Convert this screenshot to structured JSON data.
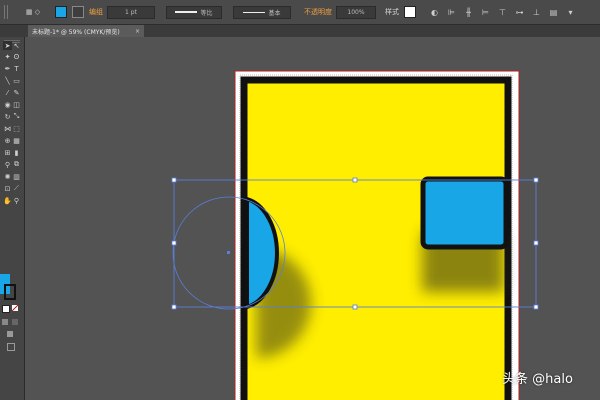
{
  "control_bar": {
    "selection_label": "编组",
    "stroke_weight": "1 pt",
    "stroke_profile": "等比",
    "brush_def": "基本",
    "opacity_label": "不透明度",
    "opacity_value": "100%",
    "style_label": "样式"
  },
  "document_tab": {
    "title": "未标题-1* @ 59% (CMYK/预览)",
    "close": "×"
  },
  "colors": {
    "fill": "#18a6e6",
    "yellow": "#ffee00",
    "stroke": "#111111",
    "artboard_border": "#b11f1f",
    "selection": "#5a7fd6"
  },
  "tools": [
    "selection-tool",
    "direct-selection-tool",
    "magic-wand-tool",
    "pen-tool",
    "type-tool",
    "line-tool",
    "rectangle-tool",
    "paintbrush-tool",
    "pencil-tool",
    "eraser-tool",
    "rotate-tool",
    "scale-tool",
    "width-tool",
    "free-transform-tool",
    "shape-builder-tool",
    "perspective-grid-tool",
    "mesh-tool",
    "gradient-tool",
    "eyedropper-tool",
    "blend-tool",
    "symbol-sprayer-tool",
    "column-graph-tool",
    "artboard-tool",
    "slice-tool",
    "hand-tool",
    "zoom-tool"
  ],
  "watermark": "头条 @halo"
}
